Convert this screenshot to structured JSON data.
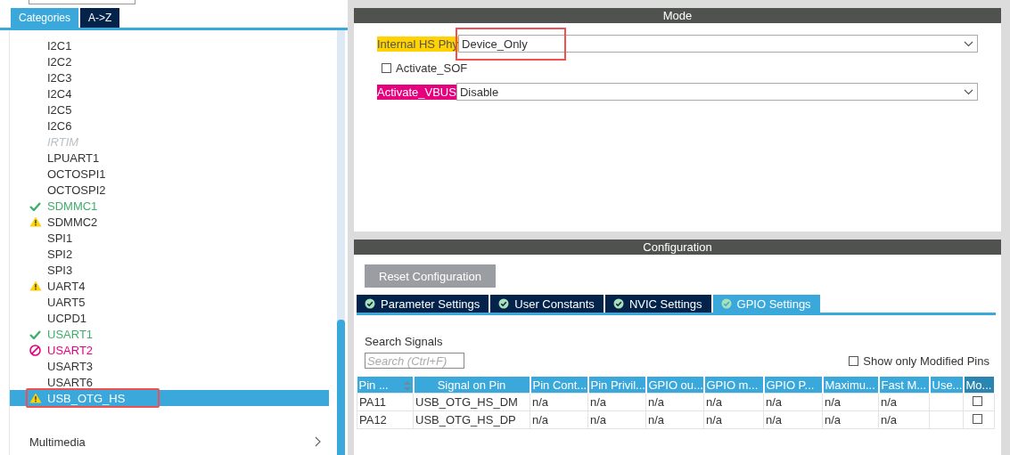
{
  "sidebar": {
    "tabs": [
      {
        "label": "Categories",
        "selected": true
      },
      {
        "label": "A->Z",
        "selected": false
      }
    ],
    "items": [
      {
        "label": "I2C1",
        "kind": "plain",
        "selected": false,
        "highlighted": false
      },
      {
        "label": "I2C2",
        "kind": "plain",
        "selected": false,
        "highlighted": false
      },
      {
        "label": "I2C3",
        "kind": "plain",
        "selected": false,
        "highlighted": false
      },
      {
        "label": "I2C4",
        "kind": "plain",
        "selected": false,
        "highlighted": false
      },
      {
        "label": "I2C5",
        "kind": "plain",
        "selected": false,
        "highlighted": false
      },
      {
        "label": "I2C6",
        "kind": "plain",
        "selected": false,
        "highlighted": false
      },
      {
        "label": "IRTIM",
        "kind": "disabled",
        "selected": false,
        "highlighted": false
      },
      {
        "label": "LPUART1",
        "kind": "plain",
        "selected": false,
        "highlighted": false
      },
      {
        "label": "OCTOSPI1",
        "kind": "plain",
        "selected": false,
        "highlighted": false
      },
      {
        "label": "OCTOSPI2",
        "kind": "plain",
        "selected": false,
        "highlighted": false
      },
      {
        "label": "SDMMC1",
        "kind": "ok",
        "selected": false,
        "highlighted": false
      },
      {
        "label": "SDMMC2",
        "kind": "warning",
        "selected": false,
        "highlighted": false
      },
      {
        "label": "SPI1",
        "kind": "plain",
        "selected": false,
        "highlighted": false
      },
      {
        "label": "SPI2",
        "kind": "plain",
        "selected": false,
        "highlighted": false
      },
      {
        "label": "SPI3",
        "kind": "plain",
        "selected": false,
        "highlighted": false
      },
      {
        "label": "UART4",
        "kind": "warning",
        "selected": false,
        "highlighted": false
      },
      {
        "label": "UART5",
        "kind": "plain",
        "selected": false,
        "highlighted": false
      },
      {
        "label": "UCPD1",
        "kind": "plain",
        "selected": false,
        "highlighted": false
      },
      {
        "label": "USART1",
        "kind": "ok",
        "selected": false,
        "highlighted": false
      },
      {
        "label": "USART2",
        "kind": "error",
        "selected": false,
        "highlighted": false
      },
      {
        "label": "USART3",
        "kind": "plain",
        "selected": false,
        "highlighted": false
      },
      {
        "label": "USART6",
        "kind": "plain",
        "selected": false,
        "highlighted": false
      },
      {
        "label": "USB_OTG_HS",
        "kind": "warning",
        "selected": true,
        "highlighted": true
      }
    ],
    "category": {
      "label": "Multimedia",
      "expanded": false
    }
  },
  "mode": {
    "title": "Mode",
    "fields": [
      {
        "kind": "select",
        "label": "Internal HS Phy",
        "color": "#ffd200",
        "value": "Device_Only",
        "highlighted": true
      },
      {
        "kind": "checkbox",
        "label": "Activate_SOF",
        "checked": false
      },
      {
        "kind": "select",
        "label": "Activate_VBUS",
        "color": "#e6007e",
        "value": "Disable",
        "highlighted": false
      }
    ]
  },
  "configuration": {
    "title": "Configuration",
    "reset_button": "Reset Configuration",
    "tabs": [
      {
        "label": "Parameter Settings",
        "selected": false
      },
      {
        "label": "User Constants",
        "selected": false
      },
      {
        "label": "NVIC Settings",
        "selected": false
      },
      {
        "label": "GPIO Settings",
        "selected": true
      }
    ],
    "search_label": "Search Signals",
    "search": {
      "placeholder": "Search (Ctrl+F)"
    },
    "show_modified": {
      "label": "Show only Modified Pins",
      "checked": false
    },
    "table": {
      "columns": [
        "Pin ...",
        "Signal on Pin",
        "Pin Cont...",
        "Pin Privil...",
        "GPIO ou...",
        "GPIO m...",
        "GPIO P...",
        "Maximu...",
        "Fast M...",
        "Use...",
        "Mo..."
      ],
      "rows": [
        {
          "cells": [
            "PA11",
            "USB_OTG_HS_DM",
            "n/a",
            "n/a",
            "n/a",
            "n/a",
            "n/a",
            "n/a",
            "n/a"
          ],
          "modified": false
        },
        {
          "cells": [
            "PA12",
            "USB_OTG_HS_DP",
            "n/a",
            "n/a",
            "n/a",
            "n/a",
            "n/a",
            "n/a",
            "n/a"
          ],
          "modified": false
        }
      ]
    }
  }
}
